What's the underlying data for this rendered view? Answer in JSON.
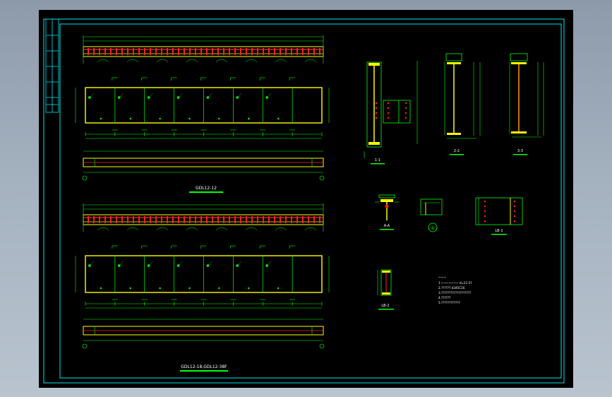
{
  "colors": {
    "background": "#000000",
    "frame": "#00e5ee",
    "line": "#00ff00",
    "beam": "#ffff00",
    "bolt": "#ff2020",
    "text": "#ffffff"
  },
  "top_drawing": {
    "title": "GDL12-12"
  },
  "bottom_drawing": {
    "title": "GDL12-18,GDL12-38F"
  },
  "sections": {
    "s11": "1-1",
    "s22": "2-2",
    "s33": "3-3",
    "saa": "A-A",
    "lb1": "LB-1",
    "lb2": "LB-2"
  },
  "detail_marker": "①",
  "notes": {
    "heading": "~~~",
    "lines": [
      "1.~~~~~~~  d=21.5?",
      "2.?????? d345C16",
      "3.???????????????????",
      "4.??????",
      "5.????????????"
    ]
  }
}
